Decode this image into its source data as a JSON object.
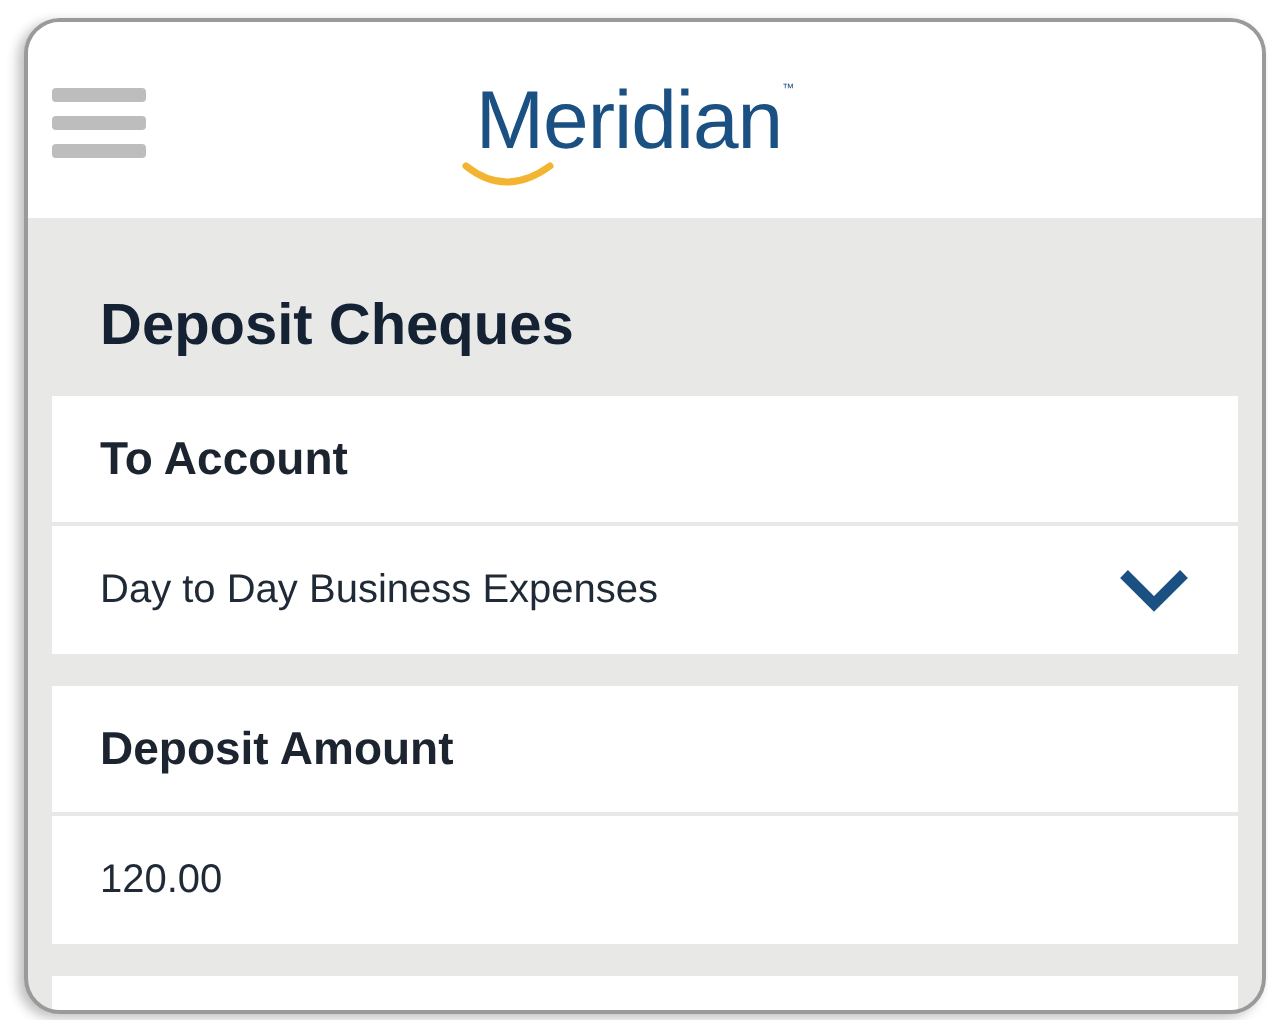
{
  "header": {
    "logo": "Meridian",
    "trademark": "™"
  },
  "title": "Deposit Cheques",
  "sections": [
    {
      "label": "To Account",
      "kind": "select",
      "value": "Day to Day Business Expenses"
    },
    {
      "label": "Deposit Amount",
      "kind": "input",
      "value": "120.00"
    }
  ]
}
